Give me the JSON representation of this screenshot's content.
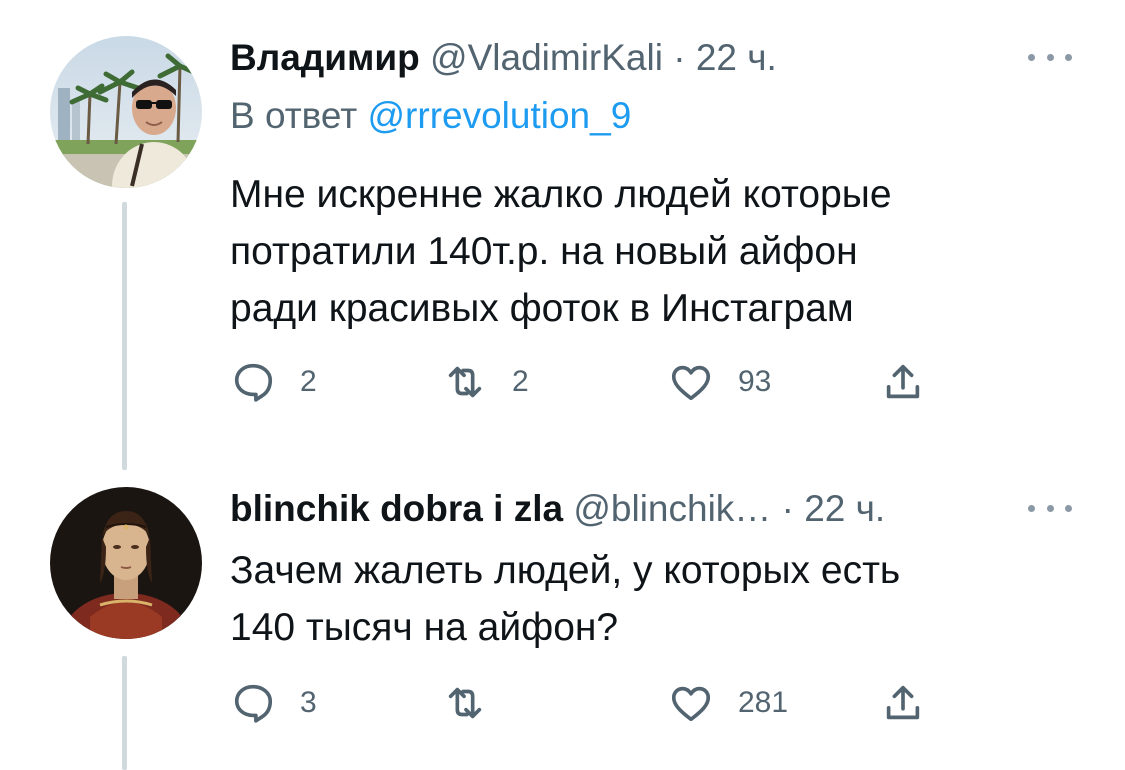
{
  "tweets": [
    {
      "display_name": "Владимир",
      "handle": "@VladimirKali",
      "separator": "·",
      "time": "22 ч.",
      "reply_prefix": "В ответ",
      "reply_mention": "@rrrevolution_9",
      "text_lines": [
        "Мне искренне жалко людей которые",
        "потратили 140т.р. на новый айфон",
        "ради красивых фоток в Инстаграм"
      ],
      "replies": "2",
      "retweets": "2",
      "likes": "93"
    },
    {
      "display_name": "blinchik dobra i zla",
      "handle": "@blinchik…",
      "separator": "·",
      "time": "22 ч.",
      "text_lines": [
        "Зачем жалеть людей, у которых есть",
        "140 тысяч на айфон?"
      ],
      "replies": "3",
      "retweets": "",
      "likes": "281"
    }
  ],
  "icons": {
    "reply": "speech-bubble-icon",
    "retweet": "retweet-arrows-icon",
    "like": "heart-outline-icon",
    "share": "share-upload-icon",
    "more": "more-dots-icon"
  },
  "colors": {
    "text_primary": "#0f1419",
    "text_secondary": "#536471",
    "mention": "#1d9bf0",
    "thread_line": "#cfd9de"
  }
}
